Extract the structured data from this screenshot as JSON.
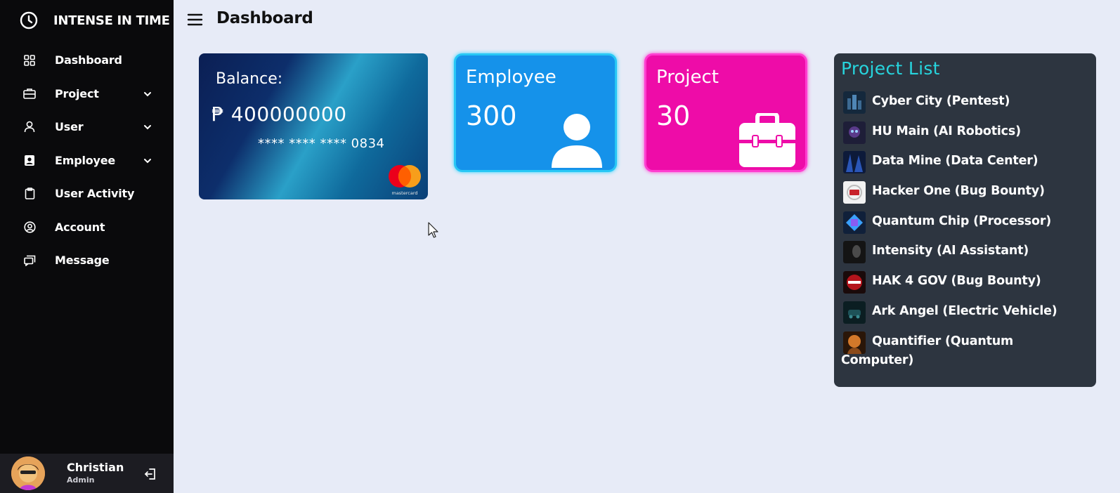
{
  "sidebar": {
    "brand": "INTENSE IN TIME",
    "items": [
      {
        "label": "Dashboard",
        "icon": "grid-icon"
      },
      {
        "label": "Project",
        "icon": "briefcase-icon"
      },
      {
        "label": "User",
        "icon": "user-icon"
      },
      {
        "label": "Employee",
        "icon": "contact-card-icon"
      },
      {
        "label": "User Activity",
        "icon": "clipboard-icon"
      },
      {
        "label": "Account",
        "icon": "account-circle-icon"
      },
      {
        "label": "Message",
        "icon": "chat-icon"
      }
    ],
    "user": {
      "name": "Christian",
      "role": "Admin"
    }
  },
  "header": {
    "title": "Dashboard"
  },
  "balance_card": {
    "label": "Balance:",
    "amount": "₱ 400000000",
    "card_number": "**** **** **** 0834",
    "brand": "mastercard"
  },
  "employee_card": {
    "title": "Employee",
    "value": "300",
    "icon": "person-icon"
  },
  "project_card": {
    "title": "Project",
    "value": "30",
    "icon": "toolbox-icon"
  },
  "project_list": {
    "title": "Project List",
    "items": [
      {
        "name": "Cyber City (Pentest)"
      },
      {
        "name": "HU Main (AI Robotics)"
      },
      {
        "name": "Data Mine (Data Center)"
      },
      {
        "name": "Hacker One (Bug Bounty)"
      },
      {
        "name": "Quantum Chip (Processor)"
      },
      {
        "name": "Intensity (AI Assistant)"
      },
      {
        "name": "HAK 4 GOV (Bug Bounty)"
      },
      {
        "name": "Ark Angel (Electric Vehicle)"
      },
      {
        "name": "Quantifier (Quantum",
        "continuation": "Computer)"
      }
    ]
  },
  "colors": {
    "sidebar_bg": "#0a0a0c",
    "page_bg": "#e7ebf7",
    "employee_card": "#1592ea",
    "project_card": "#ee0ca8",
    "project_list_bg": "#2d3540",
    "project_list_title": "#27d4dd"
  }
}
